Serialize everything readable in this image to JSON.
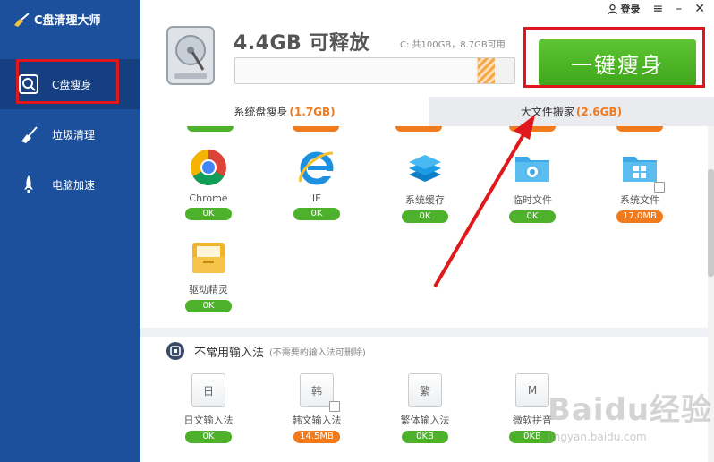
{
  "app": {
    "title": "C盘清理大师"
  },
  "sidebar": {
    "items": [
      {
        "label": "C盘瘦身",
        "icon": "disk-scan-icon",
        "active": true
      },
      {
        "label": "垃圾清理",
        "icon": "broom-icon",
        "active": false
      },
      {
        "label": "电脑加速",
        "icon": "rocket-icon",
        "active": false
      }
    ]
  },
  "header": {
    "free_title": "4.4GB 可释放",
    "capacity": "C: 共100GB，8.7GB可用",
    "used_fraction": 0.87,
    "releasable_fraction": 0.044,
    "login": "登录",
    "action_button": "一键瘦身"
  },
  "tabs": [
    {
      "label": "系统盘瘦身",
      "size": "(1.7GB)",
      "active": true
    },
    {
      "label": "大文件搬家",
      "size": "(2.6GB)",
      "active": false
    }
  ],
  "tiles": [
    {
      "name": "Chrome",
      "icon": "chrome-icon",
      "badge": "0K",
      "badge_color": "green"
    },
    {
      "name": "IE",
      "icon": "ie-icon",
      "badge": "0K",
      "badge_color": "green"
    },
    {
      "name": "系统缓存",
      "icon": "layers-icon",
      "badge": "0K",
      "badge_color": "green"
    },
    {
      "name": "临时文件",
      "icon": "temp-folder-icon",
      "badge": "0K",
      "badge_color": "green"
    },
    {
      "name": "系统文件",
      "icon": "windows-folder-icon",
      "badge": "17.0MB",
      "badge_color": "orange"
    },
    {
      "name": "驱动精灵",
      "icon": "driver-folder-icon",
      "badge": "0K",
      "badge_color": "green"
    }
  ],
  "ime_section": {
    "title": "不常用输入法",
    "hint": "(不需要的输入法可删除)",
    "items": [
      {
        "name": "日文输入法",
        "glyph": "日",
        "badge": "0K",
        "badge_color": "green"
      },
      {
        "name": "韩文输入法",
        "glyph": "韩",
        "badge": "14.5MB",
        "badge_color": "orange"
      },
      {
        "name": "繁体输入法",
        "glyph": "繁",
        "badge": "0KB",
        "badge_color": "green"
      },
      {
        "name": "微软拼音",
        "glyph": "M",
        "badge": "0KB",
        "badge_color": "green"
      }
    ]
  },
  "watermark": {
    "text": "Baidu经验",
    "sub": "jingyan.baidu.com"
  },
  "colors": {
    "sidebar": "#1c4f9c",
    "accent_green": "#4db12c",
    "accent_orange": "#f07a1c",
    "annotation_red": "#e0181b"
  }
}
